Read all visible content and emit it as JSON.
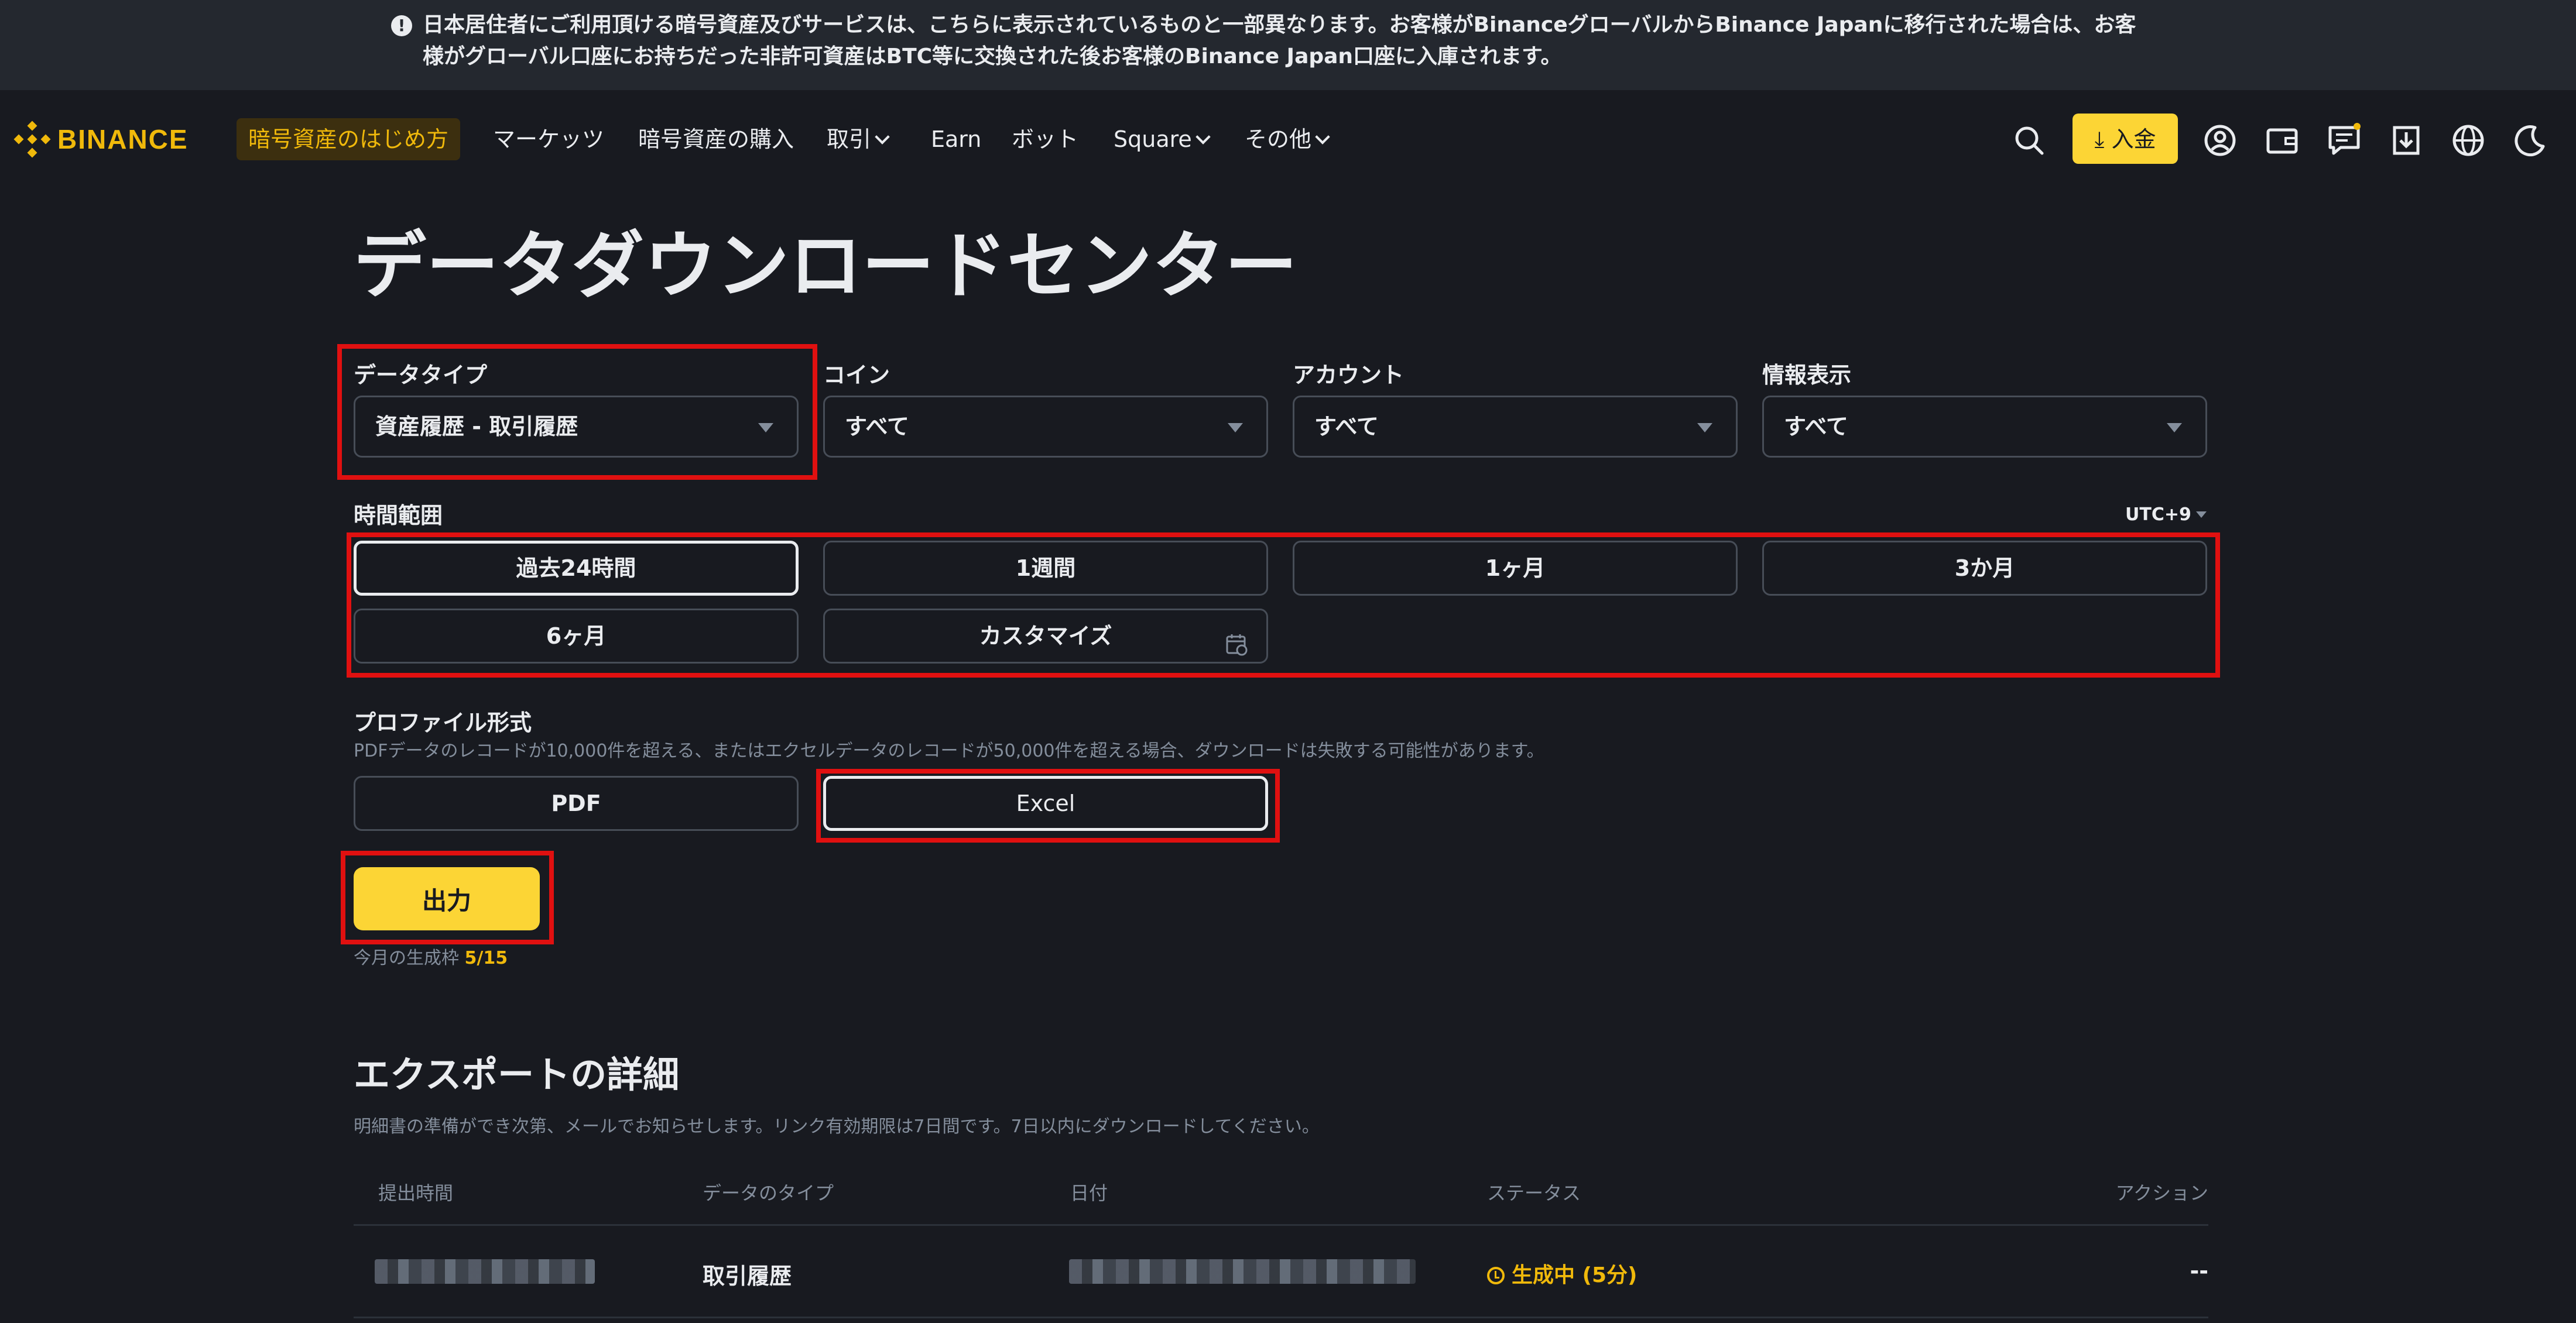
{
  "notice": {
    "text": "日本居住者にご利用頂ける暗号資産及びサービスは、こちらに表示されているものと一部異なります。お客様がBinanceグローバルからBinance Japanに移行された場合は、お客様がグローバル口座にお持ちだった非許可資産はBTC等に交換された後お客様のBinance Japan口座に入庫されます。"
  },
  "nav": {
    "logo_text": "BINANCE",
    "start": "暗号資産のはじめ方",
    "markets": "マーケッツ",
    "buy": "暗号資産の購入",
    "trade": "取引",
    "earn": "Earn",
    "bot": "ボット",
    "square": "Square",
    "more": "その他",
    "deposit": "入金"
  },
  "page": {
    "title": "データダウンロードセンター"
  },
  "filters": {
    "data_type_label": "データタイプ",
    "data_type_value": "資産履歴 - 取引履歴",
    "coin_label": "コイン",
    "coin_value": "すべて",
    "account_label": "アカウント",
    "account_value": "すべて",
    "info_label": "情報表示",
    "info_value": "すべて"
  },
  "time_range": {
    "label": "時間範囲",
    "timezone": "UTC+9",
    "options": [
      "過去24時間",
      "1週間",
      "1ヶ月",
      "3か月",
      "6ヶ月",
      "カスタマイズ"
    ],
    "selected": "過去24時間"
  },
  "file_format": {
    "label": "プロファイル形式",
    "hint": "PDFデータのレコードが10,000件を超える、またはエクセルデータのレコードが50,000件を超える場合、ダウンロードは失敗する可能性があります。",
    "options": [
      "PDF",
      "Excel"
    ],
    "selected": "Excel"
  },
  "export": {
    "button": "出力",
    "quota_label": "今月の生成枠",
    "quota_value": "5/15"
  },
  "details": {
    "title": "エクスポートの詳細",
    "description": "明細書の準備ができ次第、メールでお知らせします。リンク有効期限は7日間です。7日以内にダウンロードしてください。",
    "columns": [
      "提出時間",
      "データのタイプ",
      "日付",
      "ステータス",
      "アクション"
    ],
    "rows": [
      {
        "data_type": "取引履歴",
        "status": "生成中 (5分)",
        "action": "--"
      }
    ]
  },
  "colors": {
    "background": "#181a20",
    "accent_yellow": "#fcd535",
    "brand": "#f0b90b",
    "annotation_red": "#e01010"
  }
}
